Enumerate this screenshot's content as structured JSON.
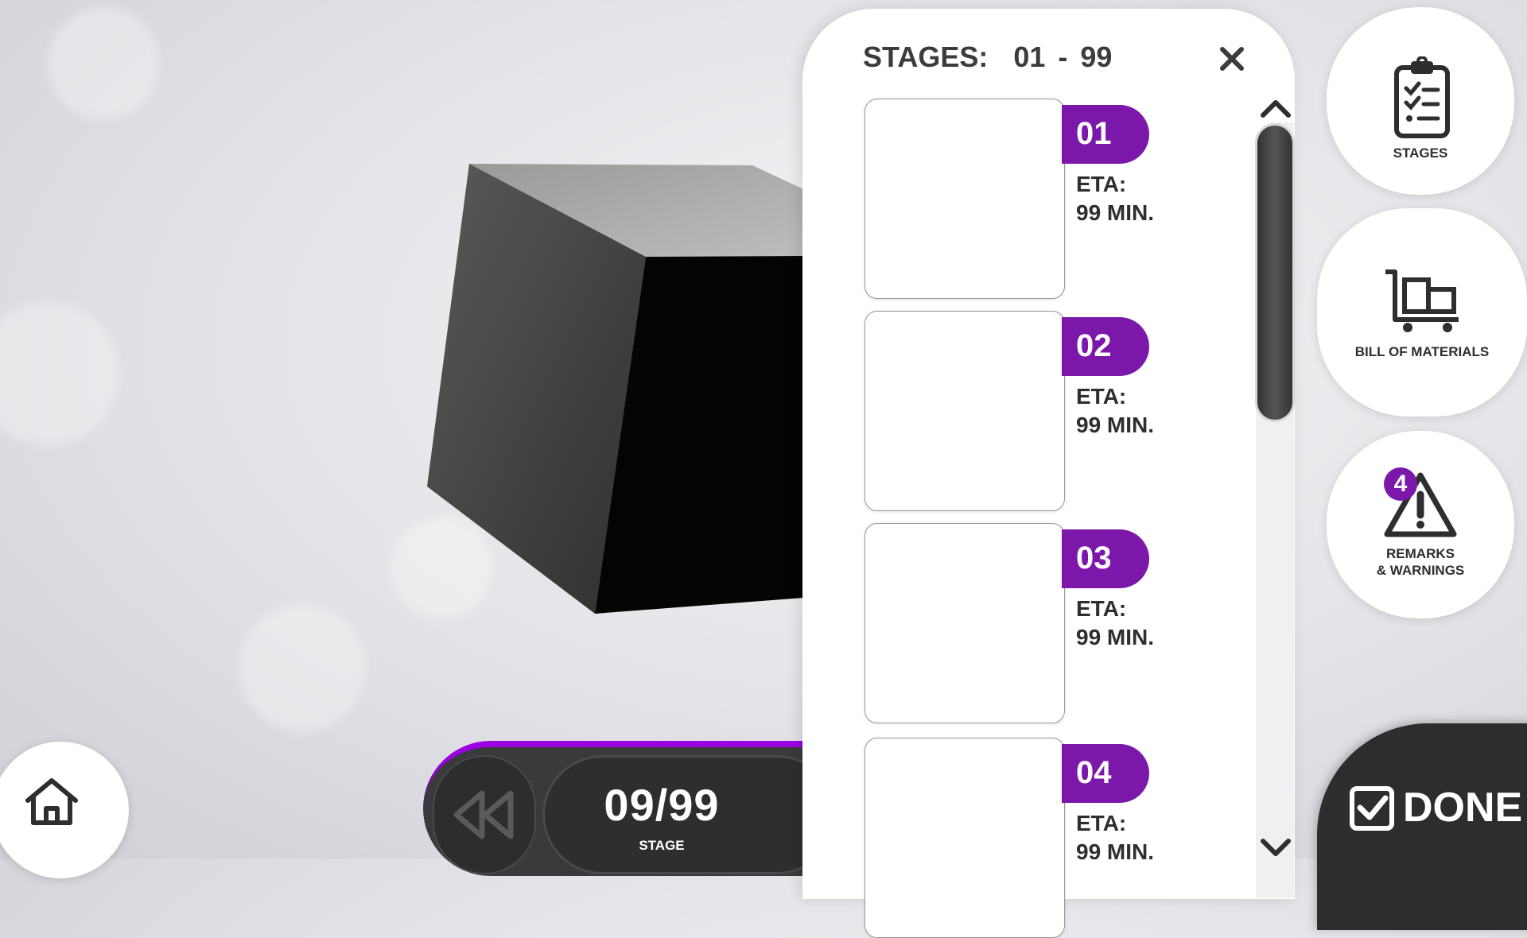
{
  "colors": {
    "accent": "#7b18aa",
    "accent_bright": "#9b00e0",
    "dark": "#2d2d2f",
    "panel": "#ffffff"
  },
  "stage_control": {
    "value": "09/99",
    "label": "STAGE"
  },
  "stages_panel": {
    "title": "STAGES:  01 - 99",
    "stages": [
      {
        "number": "01",
        "eta_label": "ETA:",
        "eta_value": "99 MIN."
      },
      {
        "number": "02",
        "eta_label": "ETA:",
        "eta_value": "99 MIN."
      },
      {
        "number": "03",
        "eta_label": "ETA:",
        "eta_value": "99 MIN."
      },
      {
        "number": "04",
        "eta_label": "ETA:",
        "eta_value": "99 MIN."
      }
    ]
  },
  "side_buttons": {
    "stages": {
      "label": "STAGES",
      "icon": "clipboard-checklist-icon"
    },
    "bom": {
      "label": "BILL OF MATERIALS",
      "icon": "cart-icon"
    },
    "remarks": {
      "label_line1": "REMARKS",
      "label_line2": "& WARNINGS",
      "badge": "4",
      "icon": "warning-icon"
    }
  },
  "done": {
    "label": "DONE",
    "icon": "checkbox-icon"
  },
  "home": {
    "icon": "home-icon"
  }
}
